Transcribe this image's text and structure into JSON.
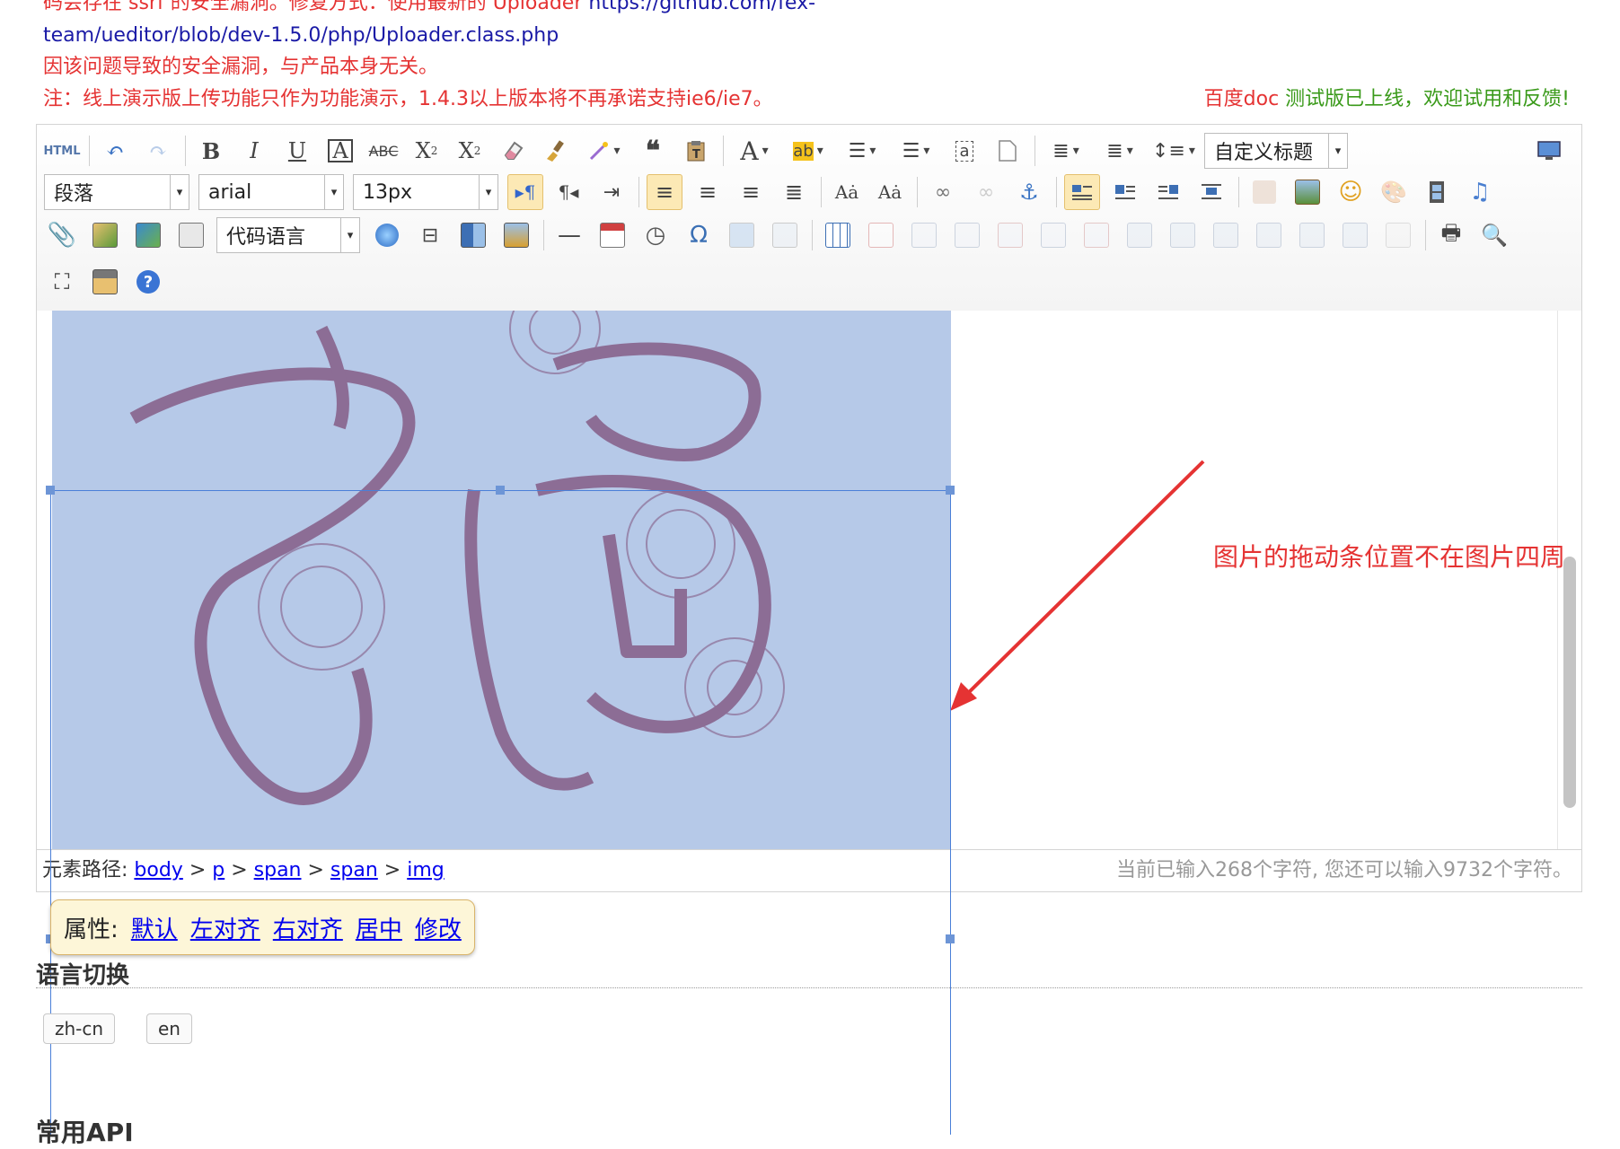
{
  "notices": {
    "line1_red": "码会存在 ssrf 的安全漏洞。修复方式：使用最新的 Uploader",
    "line1_url": "https://github.com/fex-",
    "line2_url": "team/ueditor/blob/dev-1.5.0/php/Uploader.class.php",
    "line3": "因该问题导致的安全漏洞，与产品本身无关。",
    "line4": "注：线上演示版上传功能只作为功能演示，1.4.3以上版本将不再承诺支持ie6/ie7。",
    "baidu_doc_red": "百度doc",
    "baidu_doc_green": " 测试版已上线，欢迎试用和反馈!"
  },
  "toolbar": {
    "row1": {
      "source": "HTML",
      "heading_select": "自定义标题"
    },
    "row2": {
      "paragraph_select": "段落",
      "font_family_select": "arial",
      "font_size_select": "13px"
    },
    "row3": {
      "code_language_select": "代码语言"
    }
  },
  "annotation": "图片的拖动条位置不在图片四周",
  "statusbar": {
    "path_label": "元素路径: ",
    "path": [
      "body",
      "p",
      "span",
      "span",
      "img"
    ],
    "separator": " > ",
    "wordcount": "当前已输入268个字符, 您还可以输入9732个字符。"
  },
  "image_popup": {
    "label": "属性:",
    "links": [
      "默认",
      "左对齐",
      "右对齐",
      "居中",
      "修改"
    ]
  },
  "language_section": {
    "heading": "语言切换",
    "buttons": [
      "zh-cn",
      "en"
    ]
  },
  "api_heading": "常用API",
  "colors": {
    "notice_red": "#e53333",
    "link_blue": "#1a1aa6",
    "green": "#3a9a1a",
    "selection": "#b6c9e8",
    "annotation_arrow": "#e53333"
  }
}
